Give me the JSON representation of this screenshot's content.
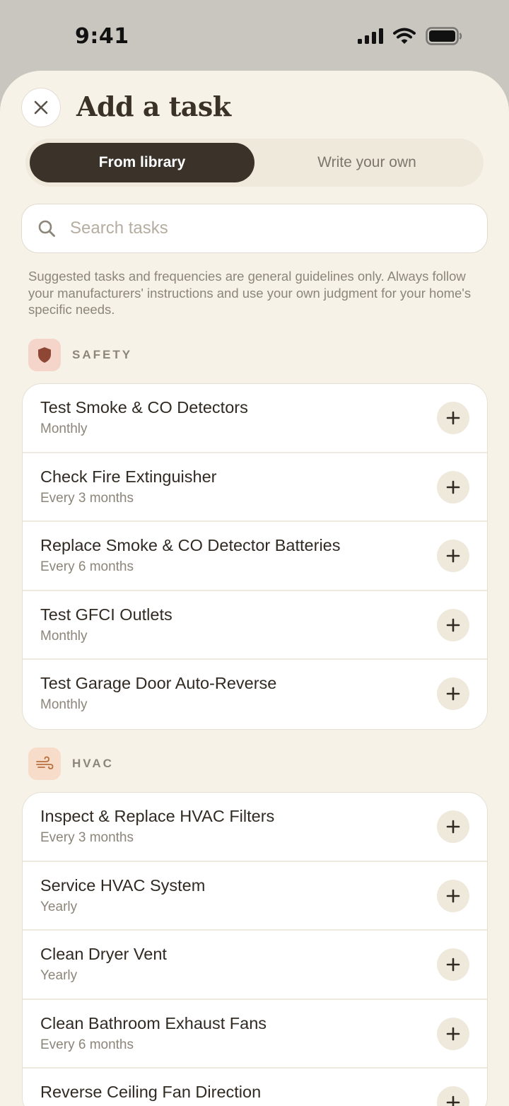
{
  "status": {
    "time": "9:41"
  },
  "header": {
    "title": "Add a task"
  },
  "tabs": [
    {
      "label": "From library",
      "active": true
    },
    {
      "label": "Write your own",
      "active": false
    }
  ],
  "search": {
    "placeholder": "Search tasks",
    "value": ""
  },
  "disclaimer": "Suggested tasks and frequencies are general guidelines only. Always follow your manufacturers' instructions and use your own judgment for your home's specific needs.",
  "sections": [
    {
      "label": "SAFETY",
      "icon": "shield-icon",
      "icon_bg": "#f5d4c9",
      "icon_color": "#8e4635",
      "tasks": [
        {
          "name": "Test Smoke & CO Detectors",
          "frequency": "Monthly"
        },
        {
          "name": "Check Fire Extinguisher",
          "frequency": "Every 3 months"
        },
        {
          "name": "Replace Smoke & CO Detector Batteries",
          "frequency": "Every 6 months"
        },
        {
          "name": "Test GFCI Outlets",
          "frequency": "Monthly"
        },
        {
          "name": "Test Garage Door Auto-Reverse",
          "frequency": "Monthly"
        }
      ]
    },
    {
      "label": "HVAC",
      "icon": "wind-icon",
      "icon_bg": "#f7dcc9",
      "icon_color": "#b8703f",
      "tasks": [
        {
          "name": "Inspect & Replace HVAC Filters",
          "frequency": "Every 3 months"
        },
        {
          "name": "Service HVAC System",
          "frequency": "Yearly"
        },
        {
          "name": "Clean Dryer Vent",
          "frequency": "Yearly"
        },
        {
          "name": "Clean Bathroom Exhaust Fans",
          "frequency": "Every 6 months"
        },
        {
          "name": "Reverse Ceiling Fan Direction",
          "frequency": ""
        }
      ]
    }
  ],
  "colors": {
    "accent": "#3b332a",
    "sheet_background": "#f7f2e8",
    "muted_text": "#8c8579"
  }
}
